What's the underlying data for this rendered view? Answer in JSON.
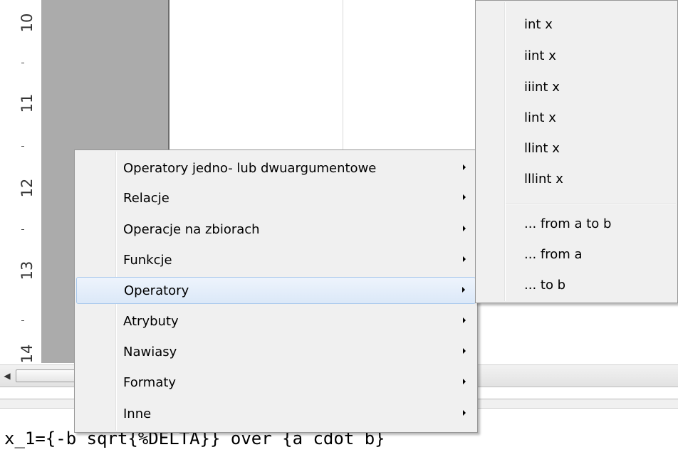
{
  "ruler": {
    "numbers": [
      "10",
      "11",
      "12",
      "13",
      "14"
    ]
  },
  "formula": {
    "text": "x_1={-b sqrt{%DELTA}} over {a cdot b}"
  },
  "context_menu": {
    "items": [
      {
        "label": "Operatory jedno- lub dwuargumentowe",
        "has_submenu": true,
        "highlighted": false
      },
      {
        "label": "Relacje",
        "has_submenu": true,
        "highlighted": false
      },
      {
        "label": "Operacje na zbiorach",
        "has_submenu": true,
        "highlighted": false
      },
      {
        "label": "Funkcje",
        "has_submenu": true,
        "highlighted": false
      },
      {
        "label": "Operatory",
        "has_submenu": true,
        "highlighted": true
      },
      {
        "label": "Atrybuty",
        "has_submenu": true,
        "highlighted": false
      },
      {
        "label": "Nawiasy",
        "has_submenu": true,
        "highlighted": false
      },
      {
        "label": "Formaty",
        "has_submenu": true,
        "highlighted": false
      },
      {
        "label": "Inne",
        "has_submenu": true,
        "highlighted": false
      }
    ]
  },
  "submenu": {
    "items": [
      {
        "label": "int x"
      },
      {
        "label": "iint x"
      },
      {
        "label": "iiint x"
      },
      {
        "label": "lint x"
      },
      {
        "label": "llint x"
      },
      {
        "label": "lllint x"
      }
    ],
    "range_items": [
      {
        "label": "... from a to b"
      },
      {
        "label": "... from a"
      },
      {
        "label": "... to b"
      }
    ]
  },
  "colors": {
    "highlight_border": "#a8c8ec",
    "menu_background": "#f0f0f0",
    "page_margin": "#ababab"
  }
}
